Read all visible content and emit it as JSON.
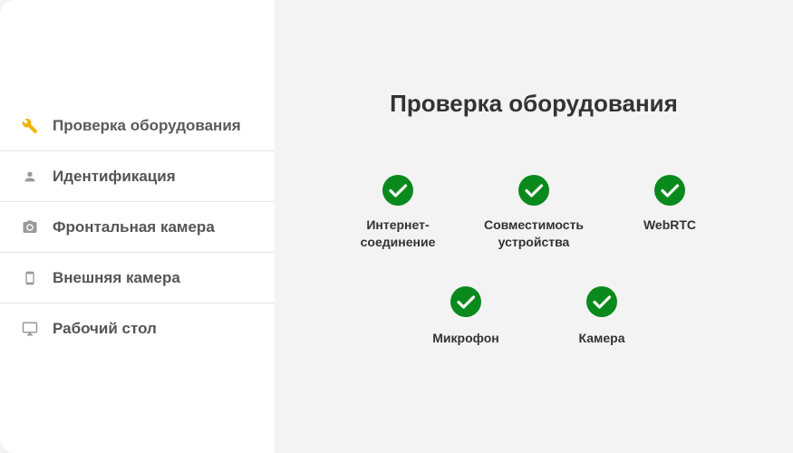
{
  "sidebar": {
    "items": [
      {
        "label": "Проверка оборудования",
        "icon": "wrench-icon",
        "active": true
      },
      {
        "label": "Идентификация",
        "icon": "person-icon",
        "active": false
      },
      {
        "label": "Фронтальная камера",
        "icon": "camera-icon",
        "active": false
      },
      {
        "label": "Внешняя камера",
        "icon": "phone-icon",
        "active": false
      },
      {
        "label": "Рабочий стол",
        "icon": "monitor-icon",
        "active": false
      }
    ]
  },
  "main": {
    "title": "Проверка оборудования",
    "checks": [
      {
        "label": "Интернет-\nсоединение",
        "status": "ok"
      },
      {
        "label": "Совместимость\nустройства",
        "status": "ok"
      },
      {
        "label": "WebRTC",
        "status": "ok"
      },
      {
        "label": "Микрофон",
        "status": "ok"
      },
      {
        "label": "Камера",
        "status": "ok"
      }
    ]
  },
  "colors": {
    "accent": "#f4b400",
    "success": "#0a8a1c",
    "text": "#333333",
    "nav_text": "#555555"
  }
}
